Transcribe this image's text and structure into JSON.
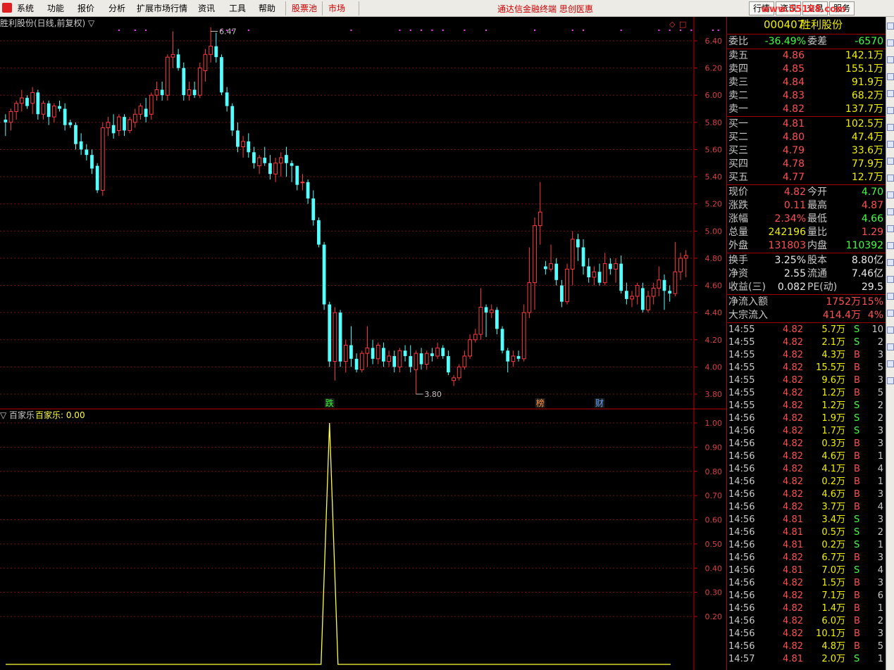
{
  "menu": {
    "items": [
      "系统",
      "功能",
      "报价",
      "分析",
      "扩展市场行情",
      "资讯",
      "工具",
      "帮助"
    ],
    "red_items": [
      "股票池",
      "市场"
    ],
    "banner": "通达信金融终端 思创医惠",
    "right_tabs": [
      "行情",
      "资讯",
      "交易",
      "服务"
    ],
    "watermark": "www.55188.com"
  },
  "chart_title": "胜利股份(日线,前复权) ▽",
  "indicator_title": "▽ 百家乐",
  "indicator_value_label": "百家乐: 0.00",
  "colors": {
    "up": "#ff3c3c",
    "down": "#54ffff",
    "indicator": "#ffff40",
    "grid": "#7a1010",
    "axis": "#c00000"
  },
  "chart_data": [
    {
      "type": "candlestick",
      "title": "胜利股份(日线,前复权)",
      "ylim": [
        3.7,
        6.6
      ],
      "yticks": [
        "6.40",
        "6.20",
        "6.00",
        "5.80",
        "5.60",
        "5.40",
        "5.20",
        "5.00",
        "4.80",
        "4.60",
        "4.40",
        "4.20",
        "4.00",
        "3.80"
      ],
      "candles": [
        [
          5.82,
          5.86,
          5.7,
          5.8
        ],
        [
          5.8,
          5.9,
          5.74,
          5.88
        ],
        [
          5.88,
          5.96,
          5.82,
          5.94
        ],
        [
          5.94,
          6.04,
          5.88,
          5.98
        ],
        [
          5.98,
          6.0,
          5.9,
          5.92
        ],
        [
          5.94,
          6.06,
          5.86,
          6.02
        ],
        [
          6.02,
          6.04,
          5.82,
          5.86
        ],
        [
          5.86,
          5.96,
          5.82,
          5.94
        ],
        [
          5.94,
          5.96,
          5.78,
          5.84
        ],
        [
          5.84,
          5.94,
          5.8,
          5.92
        ],
        [
          5.92,
          5.96,
          5.88,
          5.9
        ],
        [
          5.9,
          5.94,
          5.74,
          5.78
        ],
        [
          5.8,
          5.82,
          5.76,
          5.78
        ],
        [
          5.78,
          5.8,
          5.6,
          5.64
        ],
        [
          5.66,
          5.72,
          5.56,
          5.6
        ],
        [
          5.6,
          5.64,
          5.52,
          5.56
        ],
        [
          5.56,
          5.6,
          5.42,
          5.46
        ],
        [
          5.48,
          5.5,
          5.28,
          5.3
        ],
        [
          5.3,
          5.8,
          5.26,
          5.76
        ],
        [
          5.76,
          5.84,
          5.7,
          5.8
        ],
        [
          5.78,
          5.86,
          5.68,
          5.72
        ],
        [
          5.74,
          5.86,
          5.7,
          5.84
        ],
        [
          5.84,
          5.86,
          5.7,
          5.74
        ],
        [
          5.74,
          5.84,
          5.72,
          5.82
        ],
        [
          5.8,
          5.9,
          5.76,
          5.86
        ],
        [
          5.86,
          5.94,
          5.82,
          5.92
        ],
        [
          5.9,
          5.98,
          5.8,
          5.84
        ],
        [
          5.86,
          6.02,
          5.82,
          6.0
        ],
        [
          6.0,
          6.1,
          5.96,
          6.04
        ],
        [
          6.04,
          6.1,
          5.96,
          6.0
        ],
        [
          6.0,
          6.3,
          5.96,
          6.28
        ],
        [
          6.28,
          6.47,
          6.2,
          6.3
        ],
        [
          6.3,
          6.34,
          6.18,
          6.2
        ],
        [
          6.2,
          6.24,
          5.96,
          6.0
        ],
        [
          6.0,
          6.1,
          5.96,
          6.04
        ],
        [
          6.04,
          6.1,
          5.98,
          6.0
        ],
        [
          6.0,
          6.24,
          5.98,
          6.2
        ],
        [
          6.18,
          6.34,
          6.1,
          6.3
        ],
        [
          6.3,
          6.5,
          6.24,
          6.36
        ],
        [
          6.36,
          6.46,
          6.24,
          6.28
        ],
        [
          6.28,
          6.3,
          6.0,
          6.02
        ],
        [
          6.02,
          6.06,
          5.88,
          5.92
        ],
        [
          5.92,
          5.94,
          5.7,
          5.74
        ],
        [
          5.74,
          5.8,
          5.58,
          5.62
        ],
        [
          5.62,
          5.7,
          5.54,
          5.66
        ],
        [
          5.66,
          5.72,
          5.54,
          5.58
        ],
        [
          5.58,
          5.62,
          5.46,
          5.5
        ],
        [
          5.48,
          5.56,
          5.42,
          5.54
        ],
        [
          5.54,
          5.62,
          5.48,
          5.5
        ],
        [
          5.5,
          5.56,
          5.38,
          5.42
        ],
        [
          5.42,
          5.54,
          5.36,
          5.5
        ],
        [
          5.5,
          5.58,
          5.4,
          5.54
        ],
        [
          5.56,
          5.62,
          5.4,
          5.5
        ],
        [
          5.5,
          5.52,
          5.36,
          5.48
        ],
        [
          5.48,
          5.48,
          5.3,
          5.34
        ],
        [
          5.36,
          5.42,
          5.3,
          5.36
        ],
        [
          5.36,
          5.38,
          5.2,
          5.24
        ],
        [
          5.24,
          5.3,
          5.04,
          5.08
        ],
        [
          5.08,
          5.1,
          4.88,
          4.9
        ],
        [
          4.9,
          4.92,
          4.42,
          4.46
        ],
        [
          4.46,
          4.48,
          4.0,
          4.04
        ],
        [
          4.04,
          4.44,
          3.9,
          4.4
        ],
        [
          4.4,
          4.42,
          4.0,
          4.04
        ],
        [
          4.04,
          4.2,
          3.96,
          4.16
        ],
        [
          4.16,
          4.3,
          4.0,
          4.06
        ],
        [
          4.06,
          4.1,
          3.96,
          3.98
        ],
        [
          3.98,
          4.12,
          3.96,
          4.1
        ],
        [
          4.1,
          4.3,
          4.0,
          4.14
        ],
        [
          4.14,
          4.2,
          4.02,
          4.06
        ],
        [
          4.06,
          4.18,
          4.02,
          4.16
        ],
        [
          4.14,
          4.18,
          4.0,
          4.04
        ],
        [
          4.04,
          4.12,
          4.0,
          4.08
        ],
        [
          4.08,
          4.12,
          3.96,
          4.0
        ],
        [
          4.0,
          4.14,
          3.96,
          4.12
        ],
        [
          4.12,
          4.16,
          4.04,
          4.08
        ],
        [
          4.08,
          4.16,
          3.96,
          4.0
        ],
        [
          3.98,
          4.12,
          3.8,
          4.1
        ],
        [
          4.1,
          4.14,
          3.98,
          4.02
        ],
        [
          4.02,
          4.12,
          3.98,
          4.1
        ],
        [
          4.1,
          4.14,
          4.04,
          4.08
        ],
        [
          4.08,
          4.18,
          4.06,
          4.14
        ],
        [
          4.14,
          4.16,
          4.06,
          4.08
        ],
        [
          4.08,
          4.12,
          3.94,
          3.96
        ],
        [
          3.9,
          3.94,
          3.86,
          3.92
        ],
        [
          3.92,
          4.02,
          3.9,
          4.0
        ],
        [
          4.0,
          4.12,
          3.98,
          4.08
        ],
        [
          4.08,
          4.24,
          4.06,
          4.2
        ],
        [
          4.2,
          4.28,
          4.18,
          4.24
        ],
        [
          4.24,
          4.58,
          4.2,
          4.44
        ],
        [
          4.44,
          4.46,
          4.22,
          4.4
        ],
        [
          4.4,
          4.46,
          4.36,
          4.42
        ],
        [
          4.42,
          4.44,
          4.24,
          4.28
        ],
        [
          4.28,
          4.3,
          4.1,
          4.12
        ],
        [
          4.12,
          4.14,
          3.96,
          4.04
        ],
        [
          4.04,
          4.12,
          4.0,
          4.08
        ],
        [
          4.08,
          4.12,
          4.04,
          4.06
        ],
        [
          4.06,
          4.46,
          4.04,
          4.4
        ],
        [
          4.4,
          4.88,
          4.36,
          4.62
        ],
        [
          4.62,
          5.1,
          4.42,
          5.04
        ],
        [
          5.04,
          5.36,
          4.9,
          5.14
        ],
        [
          4.74,
          4.78,
          4.68,
          4.72
        ],
        [
          4.72,
          4.9,
          4.7,
          4.76
        ],
        [
          4.76,
          4.8,
          4.6,
          4.64
        ],
        [
          4.6,
          4.64,
          4.44,
          4.48
        ],
        [
          4.48,
          4.76,
          4.46,
          4.72
        ],
        [
          4.72,
          5.0,
          4.6,
          4.94
        ],
        [
          4.94,
          4.98,
          4.78,
          4.88
        ],
        [
          4.88,
          4.94,
          4.68,
          4.74
        ],
        [
          4.74,
          4.8,
          4.62,
          4.66
        ],
        [
          4.66,
          4.74,
          4.6,
          4.7
        ],
        [
          4.7,
          4.76,
          4.6,
          4.62
        ],
        [
          4.62,
          4.84,
          4.6,
          4.76
        ],
        [
          4.76,
          4.8,
          4.68,
          4.72
        ],
        [
          4.72,
          4.8,
          4.62,
          4.76
        ],
        [
          4.76,
          4.82,
          4.54,
          4.56
        ],
        [
          4.56,
          4.62,
          4.46,
          4.5
        ],
        [
          4.5,
          4.56,
          4.44,
          4.52
        ],
        [
          4.52,
          4.62,
          4.46,
          4.6
        ],
        [
          4.58,
          4.62,
          4.4,
          4.42
        ],
        [
          4.42,
          4.56,
          4.4,
          4.52
        ],
        [
          4.52,
          4.62,
          4.46,
          4.58
        ],
        [
          4.58,
          4.74,
          4.52,
          4.64
        ],
        [
          4.64,
          4.68,
          4.42,
          4.56
        ],
        [
          4.56,
          4.6,
          4.48,
          4.54
        ],
        [
          4.54,
          4.92,
          4.52,
          4.7
        ],
        [
          4.7,
          4.84,
          4.64,
          4.8
        ],
        [
          4.8,
          4.86,
          4.66,
          4.82
        ]
      ],
      "annotations": [
        {
          "text": "6.47",
          "price": 6.47
        },
        {
          "text": "3.80",
          "price": 3.8
        }
      ],
      "events": [
        {
          "text": "跌",
          "index": 60,
          "color": "#30ff30"
        },
        {
          "text": "榜",
          "index": 99,
          "color": "#ff9040"
        },
        {
          "text": "财",
          "index": 110,
          "color": "#60a0ff"
        }
      ],
      "top_dots": [
        21,
        24,
        26,
        40,
        41,
        42,
        45,
        64,
        73,
        75,
        77,
        79,
        81,
        85,
        89,
        98,
        105,
        107,
        114,
        121,
        123,
        125,
        127,
        131,
        132
      ]
    },
    {
      "type": "line",
      "title": "百家乐",
      "ylim": [
        0,
        1.05
      ],
      "yticks": [
        "1.00",
        "0.90",
        "0.80",
        "0.70",
        "0.60",
        "0.50",
        "0.40",
        "0.30",
        "0.20"
      ],
      "spike_index": 60,
      "values_note": "0 everywhere except 1.00 at spike_index"
    }
  ],
  "quote": {
    "code": "000407",
    "name": "胜利股份",
    "weibi": {
      "label": "委比",
      "value": "-36.49%",
      "label2": "委差",
      "value2": "-6570"
    },
    "sell": [
      {
        "label": "卖五",
        "price": "4.86",
        "vol": "142.1万"
      },
      {
        "label": "卖四",
        "price": "4.85",
        "vol": "155.1万"
      },
      {
        "label": "卖三",
        "price": "4.84",
        "vol": "91.9万"
      },
      {
        "label": "卖二",
        "price": "4.83",
        "vol": "68.2万"
      },
      {
        "label": "卖一",
        "price": "4.82",
        "vol": "137.7万"
      }
    ],
    "buy": [
      {
        "label": "买一",
        "price": "4.81",
        "vol": "102.5万"
      },
      {
        "label": "买二",
        "price": "4.80",
        "vol": "47.4万"
      },
      {
        "label": "买三",
        "price": "4.79",
        "vol": "33.6万"
      },
      {
        "label": "买四",
        "price": "4.78",
        "vol": "77.9万"
      },
      {
        "label": "买五",
        "price": "4.77",
        "vol": "12.7万"
      }
    ],
    "stats1": [
      {
        "l1": "现价",
        "v1": "4.82",
        "c1": "red",
        "l2": "今开",
        "v2": "4.70",
        "c2": "green"
      },
      {
        "l1": "涨跌",
        "v1": "0.11",
        "c1": "red",
        "l2": "最高",
        "v2": "4.87",
        "c2": "red"
      },
      {
        "l1": "涨幅",
        "v1": "2.34%",
        "c1": "red",
        "l2": "最低",
        "v2": "4.66",
        "c2": "green"
      },
      {
        "l1": "总量",
        "v1": "242196",
        "c1": "yel",
        "l2": "量比",
        "v2": "1.29",
        "c2": "red"
      },
      {
        "l1": "外盘",
        "v1": "131803",
        "c1": "red",
        "l2": "内盘",
        "v2": "110392",
        "c2": "green"
      }
    ],
    "stats2": [
      {
        "l1": "换手",
        "v1": "3.25%",
        "c1": "white",
        "l2": "股本",
        "v2": "8.80亿",
        "c2": "white"
      },
      {
        "l1": "净资",
        "v1": "2.55",
        "c1": "white",
        "l2": "流通",
        "v2": "7.46亿",
        "c2": "white"
      },
      {
        "l1": "收益(三)",
        "v1": "0.082",
        "c1": "white",
        "l2": "PE(动)",
        "v2": "29.5",
        "c2": "white"
      }
    ],
    "flows": [
      {
        "label": "净流入额",
        "value": "1752万",
        "pct": "15%"
      },
      {
        "label": "大宗流入",
        "value": "414.4万",
        "pct": "4%"
      }
    ],
    "ticks": [
      [
        "14:55",
        "4.82",
        "5.7万",
        "S",
        "10"
      ],
      [
        "14:55",
        "4.82",
        "2.1万",
        "S",
        "2"
      ],
      [
        "14:55",
        "4.82",
        "4.3万",
        "B",
        "3"
      ],
      [
        "14:55",
        "4.82",
        "15.5万",
        "B",
        "5"
      ],
      [
        "14:55",
        "4.82",
        "9.6万",
        "B",
        "3"
      ],
      [
        "14:55",
        "4.82",
        "1.2万",
        "B",
        "5"
      ],
      [
        "14:55",
        "4.82",
        "1.2万",
        "S",
        "2"
      ],
      [
        "14:56",
        "4.82",
        "1.9万",
        "S",
        "2"
      ],
      [
        "14:56",
        "4.82",
        "1.7万",
        "S",
        "3"
      ],
      [
        "14:56",
        "4.82",
        "0.3万",
        "B",
        "3"
      ],
      [
        "14:56",
        "4.82",
        "4.6万",
        "B",
        "1"
      ],
      [
        "14:56",
        "4.82",
        "4.1万",
        "B",
        "4"
      ],
      [
        "14:56",
        "4.82",
        "0.2万",
        "B",
        "1"
      ],
      [
        "14:56",
        "4.82",
        "4.6万",
        "B",
        "3"
      ],
      [
        "14:56",
        "4.82",
        "3.7万",
        "B",
        "4"
      ],
      [
        "14:56",
        "4.81",
        "3.4万",
        "S",
        "3"
      ],
      [
        "14:56",
        "4.81",
        "0.5万",
        "S",
        "2"
      ],
      [
        "14:56",
        "4.81",
        "0.2万",
        "S",
        "1"
      ],
      [
        "14:56",
        "4.82",
        "6.7万",
        "B",
        "3"
      ],
      [
        "14:56",
        "4.81",
        "7.0万",
        "S",
        "4"
      ],
      [
        "14:56",
        "4.82",
        "1.5万",
        "B",
        "3"
      ],
      [
        "14:56",
        "4.82",
        "7.1万",
        "B",
        "6"
      ],
      [
        "14:56",
        "4.82",
        "1.4万",
        "B",
        "1"
      ],
      [
        "14:56",
        "4.82",
        "6.0万",
        "B",
        "2"
      ],
      [
        "14:56",
        "4.82",
        "10.1万",
        "B",
        "3"
      ],
      [
        "14:56",
        "4.82",
        "4.8万",
        "B",
        "5"
      ],
      [
        "14:57",
        "4.81",
        "2.0万",
        "S",
        "1"
      ]
    ]
  }
}
